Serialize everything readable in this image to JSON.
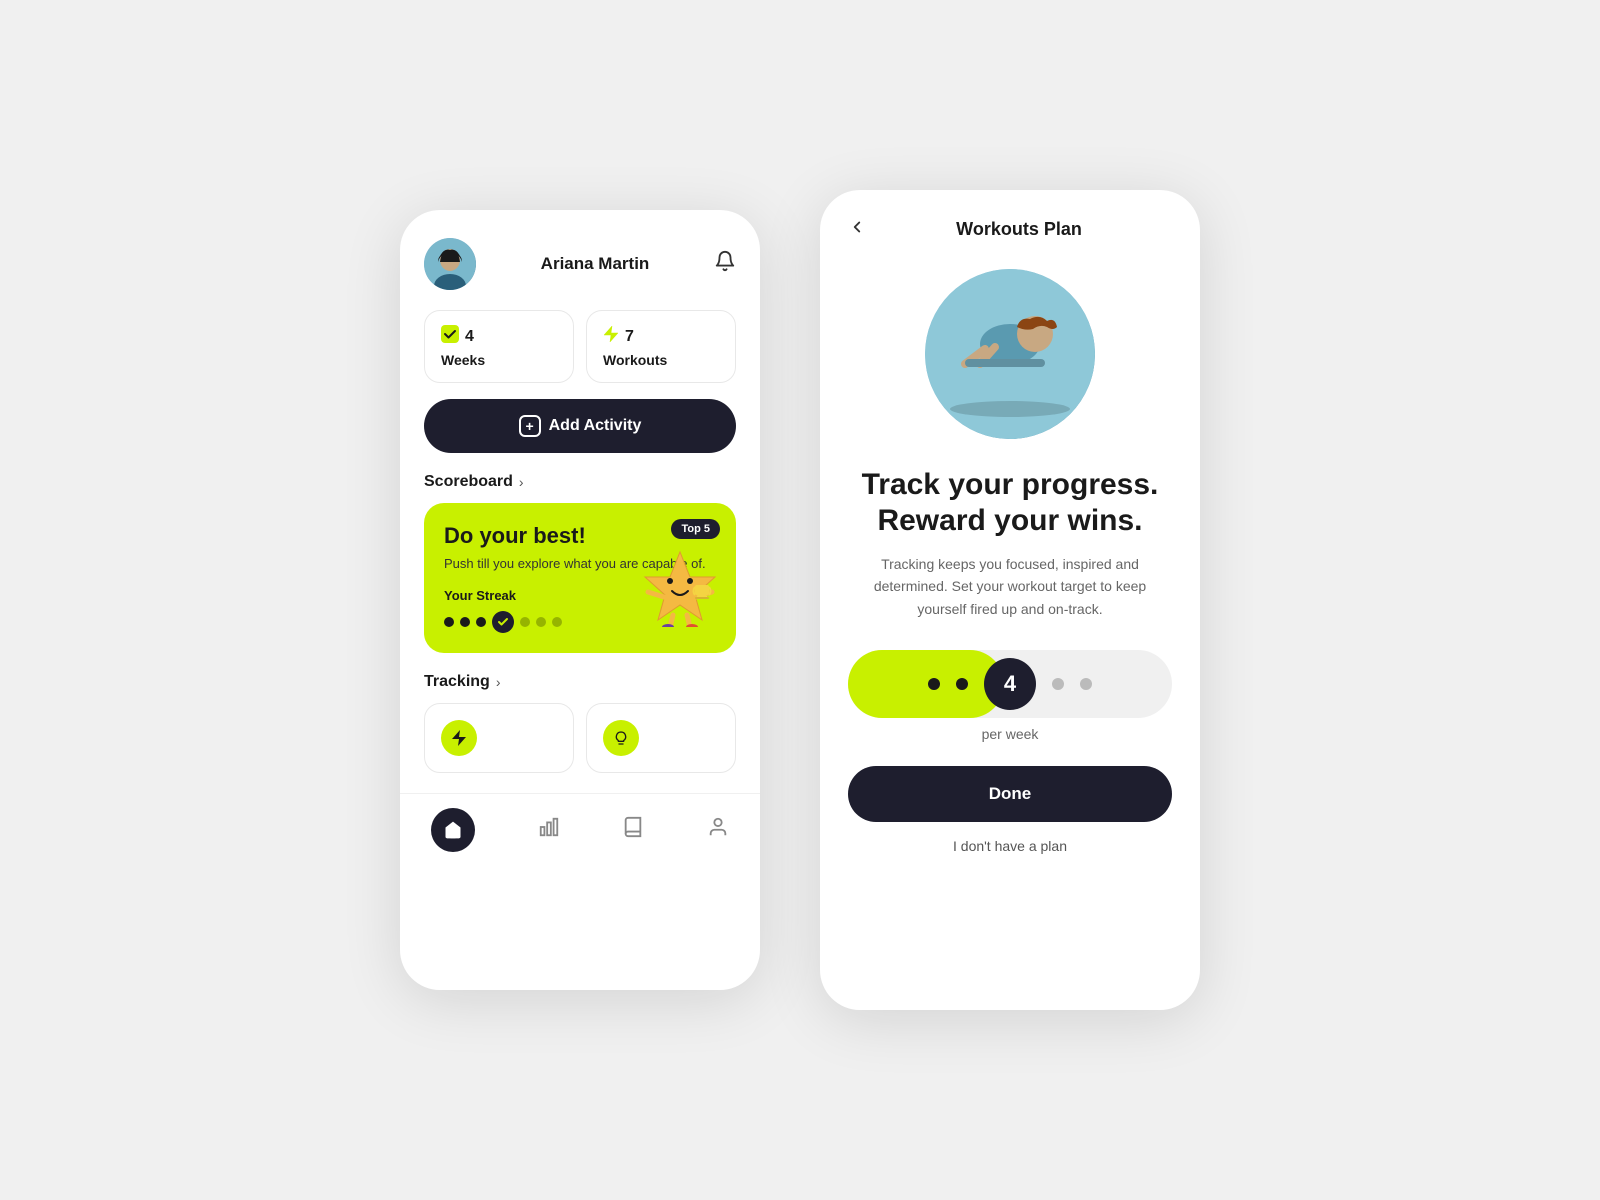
{
  "leftPhone": {
    "header": {
      "userName": "Ariana Martin",
      "bellIcon": "🔔",
      "avatarEmoji": "👩"
    },
    "stats": [
      {
        "icon": "☑",
        "number": "4",
        "label": "Weeks"
      },
      {
        "icon": "⚡",
        "number": "7",
        "label": "Workouts"
      }
    ],
    "addActivityBtn": "Add Activity",
    "scoreboard": {
      "sectionTitle": "Scoreboard",
      "badgeText": "Top 5",
      "mainTitle": "Do your best!",
      "subText": "Push till you explore what you are capable of.",
      "streakLabel": "Your Streak",
      "mascotEmoji": "⭐"
    },
    "tracking": {
      "sectionTitle": "Tracking"
    },
    "bottomNav": {
      "homeIcon": "🏠",
      "chartIcon": "📊",
      "bookIcon": "📖",
      "profileIcon": "👤"
    }
  },
  "rightPhone": {
    "header": {
      "backIcon": "‹",
      "title": "Workouts Plan"
    },
    "imageEmoji": "🏋",
    "mainTitle": "Track your progress. Reward your wins.",
    "subText": "Tracking keeps you focused, inspired and determined. Set your workout target to keep yourself fired up and on-track.",
    "stepper": {
      "value": "4",
      "perWeekLabel": "per week",
      "dots": [
        "filled",
        "filled",
        "active",
        "grey",
        "grey"
      ]
    },
    "doneBtn": "Done",
    "noPlanLink": "I don't have a plan"
  }
}
